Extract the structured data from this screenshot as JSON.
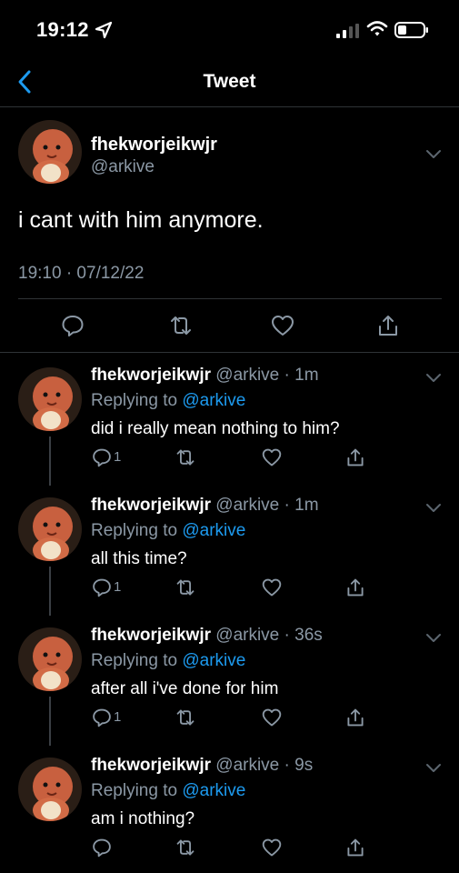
{
  "status_bar": {
    "time": "19:12"
  },
  "nav": {
    "title": "Tweet"
  },
  "main_tweet": {
    "display_name": "fhekworjeikwjr",
    "handle": "@arkive",
    "text": "i cant with him anymore.",
    "meta": "19:10 · 07/12/22"
  },
  "replies": [
    {
      "display_name": "fhekworjeikwjr",
      "handle_time": "@arkive · 1m",
      "replying_prefix": "Replying to ",
      "replying_to": "@arkive",
      "text": "did i really mean nothing to him?",
      "reply_count": "1"
    },
    {
      "display_name": "fhekworjeikwjr",
      "handle_time": "@arkive · 1m",
      "replying_prefix": "Replying to ",
      "replying_to": "@arkive",
      "text": "all this time?",
      "reply_count": "1"
    },
    {
      "display_name": "fhekworjeikwjr",
      "handle_time": "@arkive · 36s",
      "replying_prefix": "Replying to ",
      "replying_to": "@arkive",
      "text": "after all i've done for him",
      "reply_count": "1"
    },
    {
      "display_name": "fhekworjeikwjr",
      "handle_time": "@arkive · 9s",
      "replying_prefix": "Replying to ",
      "replying_to": "@arkive",
      "text": "am i nothing?",
      "reply_count": ""
    }
  ],
  "icons": {
    "status": [
      "location-arrow-icon",
      "cellular-signal-icon",
      "wifi-icon",
      "battery-icon"
    ],
    "nav": [
      "back-chevron-icon"
    ],
    "actions": [
      "reply-icon",
      "retweet-icon",
      "like-icon",
      "share-icon"
    ],
    "menu": "chevron-down-icon"
  },
  "colors": {
    "background": "#000000",
    "accent": "#1d9bf0",
    "secondary_text": "#8b98a5",
    "divider": "#2f3336"
  }
}
